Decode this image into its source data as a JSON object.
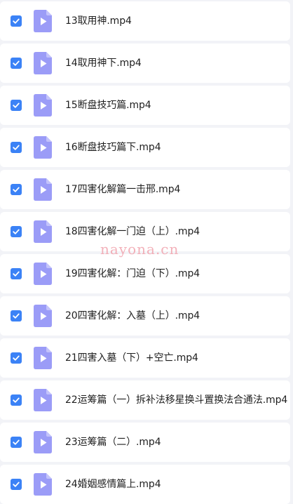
{
  "files": [
    {
      "name": "13取用神.mp4",
      "checked": true,
      "icon": "video-file-icon"
    },
    {
      "name": "14取用神下.mp4",
      "checked": true,
      "icon": "video-file-icon"
    },
    {
      "name": "15断盘技巧篇.mp4",
      "checked": true,
      "icon": "video-file-icon"
    },
    {
      "name": "16断盘技巧篇下.mp4",
      "checked": true,
      "icon": "video-file-icon"
    },
    {
      "name": "17四害化解篇一击邢.mp4",
      "checked": true,
      "icon": "video-file-icon"
    },
    {
      "name": "18四害化解一门迫（上）.mp4",
      "checked": true,
      "icon": "video-file-icon"
    },
    {
      "name": "19四害化解：门迫（下）.mp4",
      "checked": true,
      "icon": "video-file-icon"
    },
    {
      "name": "20四害化解：入墓（上）.mp4",
      "checked": true,
      "icon": "video-file-icon"
    },
    {
      "name": "21四害入墓（下）+空亡.mp4",
      "checked": true,
      "icon": "video-file-icon"
    },
    {
      "name": "22运筹篇（一）拆补法移星换斗置换法合通法.mp4",
      "checked": true,
      "icon": "video-file-icon"
    },
    {
      "name": "23运筹篇（二）.mp4",
      "checked": true,
      "icon": "video-file-icon"
    },
    {
      "name": "24婚姻感情篇上.mp4",
      "checked": true,
      "icon": "video-file-icon"
    }
  ],
  "watermark": "nayona.cn",
  "colors": {
    "background": "#f2f3f7",
    "row": "#ffffff",
    "checkbox": "#3b82f6",
    "icon": "#9b9cf7",
    "icon_fold": "#c3c3fb",
    "watermark": "#f1a4ae"
  }
}
